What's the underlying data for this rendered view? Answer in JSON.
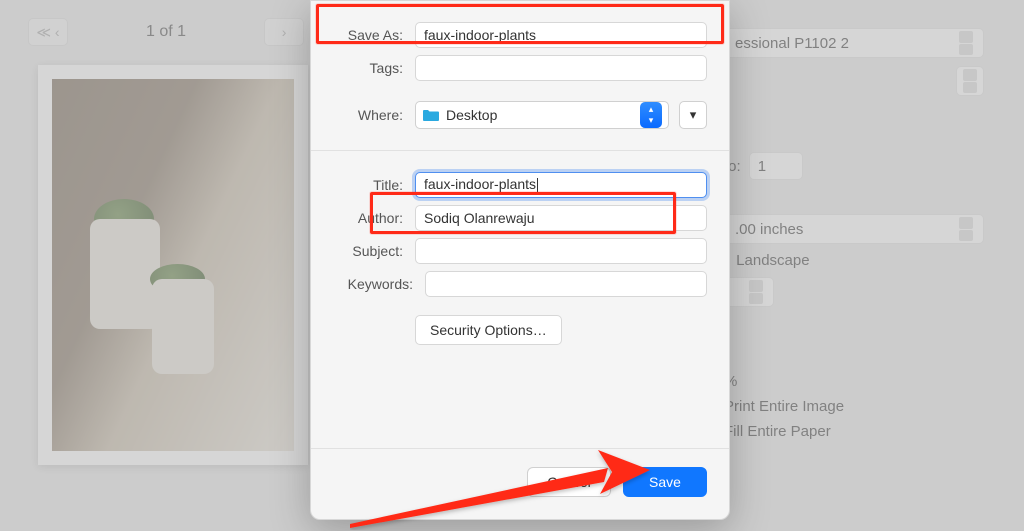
{
  "nav": {
    "page_indicator": "1 of 1"
  },
  "right_panel": {
    "printer_text": "essional P1102 2",
    "to_label": "to:",
    "to_value": "1",
    "size_text": ".00 inches",
    "orientation_text": "Landscape",
    "scale_suffix": "%",
    "print_entire_image": "Print Entire Image",
    "fill_entire_paper": "Fill Entire Paper"
  },
  "sheet": {
    "save_as": {
      "label": "Save As:",
      "value": "faux-indoor-plants"
    },
    "tags": {
      "label": "Tags:",
      "value": ""
    },
    "where": {
      "label": "Where:",
      "value": "Desktop"
    },
    "title": {
      "label": "Title:",
      "value": "faux-indoor-plants"
    },
    "author": {
      "label": "Author:",
      "value": "Sodiq Olanrewaju"
    },
    "subject": {
      "label": "Subject:",
      "value": ""
    },
    "keywords": {
      "label": "Keywords:",
      "value": ""
    },
    "security_options": "Security Options…",
    "cancel": "Cancel",
    "save": "Save"
  }
}
